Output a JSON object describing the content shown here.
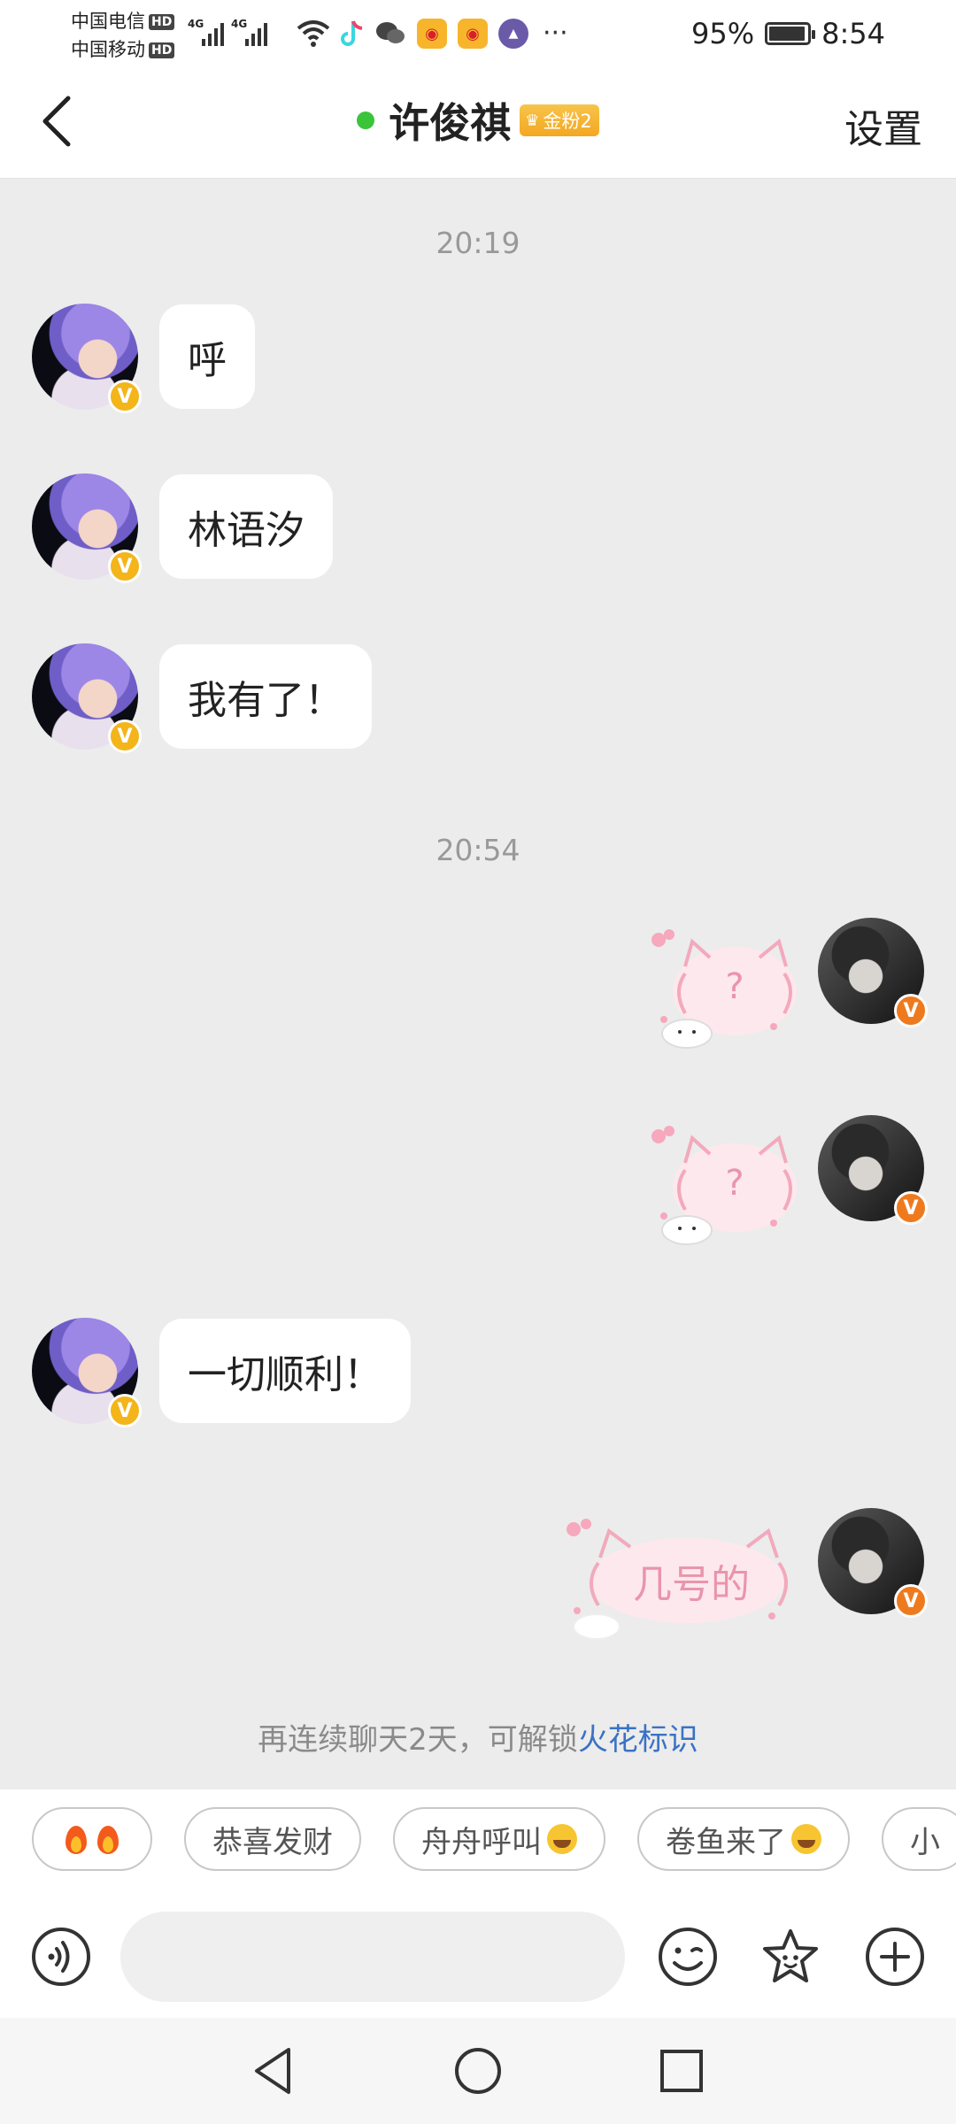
{
  "status_bar": {
    "carrier1": "中国电信",
    "carrier2": "中国移动",
    "hd": "HD",
    "net": "4G",
    "battery": "95%",
    "battery_level": 0.95,
    "time": "8:54"
  },
  "header": {
    "title": "许俊祺",
    "fan_badge": "金粉2",
    "settings": "设置"
  },
  "chat": {
    "timestamps": [
      "20:19",
      "20:54"
    ],
    "messages": [
      {
        "side": "left",
        "type": "text",
        "text": "呼"
      },
      {
        "side": "left",
        "type": "text",
        "text": "林语汐"
      },
      {
        "side": "left",
        "type": "text",
        "text": "我有了！"
      },
      {
        "side": "right",
        "type": "sticker",
        "text": "?"
      },
      {
        "side": "right",
        "type": "sticker",
        "text": "?"
      },
      {
        "side": "left",
        "type": "text",
        "text": "一切顺利！"
      },
      {
        "side": "right",
        "type": "sticker",
        "text": "几号的"
      }
    ],
    "verified_badge": "V",
    "streak_prefix": "再连续聊天2天，可解锁",
    "streak_link": "火花标识"
  },
  "quick_replies": [
    "恭喜发财",
    "舟舟呼叫",
    "卷鱼来了",
    "小"
  ],
  "input": {
    "value": "",
    "placeholder": ""
  },
  "colors": {
    "online": "#3ac43a",
    "link": "#3a72c4",
    "badge_gold": "#f3b51a",
    "badge_orange": "#ef7a1e",
    "fan_badge": "#f3a722"
  }
}
